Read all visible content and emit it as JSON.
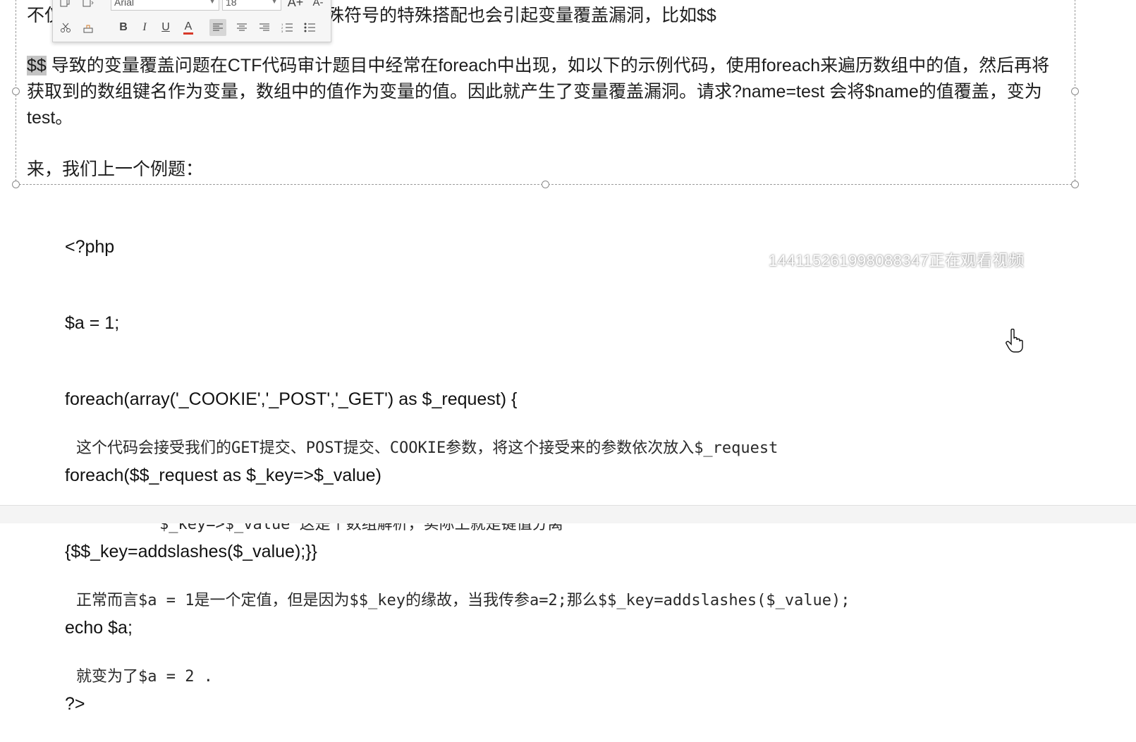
{
  "text_box": {
    "para1": "不仅仅是函数会导致变量覆盖，有些特殊符号的特殊搭配也会引起变量覆盖漏洞，比如$$",
    "para2_selected": "$$",
    "para2_rest": " 导致的变量覆盖问题在CTF代码审计题目中经常在foreach中出现，如以下的示例代码，使用foreach来遍历数组中的值，然后再将获取到的数组键名作为变量，数组中的值作为变量的值。因此就产生了变量覆盖漏洞。请求?name=test 会将$name的值覆盖，变为test。",
    "para3": "来，我们上一个例题："
  },
  "toolbar": {
    "font_name": "Arial",
    "font_size": "18",
    "grow_font": "A+",
    "shrink_font": "A-",
    "bold": "B",
    "italic": "I",
    "underline": "U",
    "font_color": "A"
  },
  "code": {
    "lines": [
      "<?php",
      "$a = 1;",
      "foreach(array('_COOKIE','_POST','_GET') as $_request) {",
      "foreach($$_request as $_key=>$_value)",
      "{$$_key=addslashes($_value);}}",
      "echo $a;",
      "?>"
    ]
  },
  "notes": {
    "line1": "这个代码会接受我们的GET提交、POST提交、COOKIE参数，将这个接受来的参数依次放入$_request",
    "line2": "$_key=>$_value 这是个数组解析，实际上就是键值分离",
    "line3": "正常而言$a = 1是一个定值，但是因为$$_key的缘故，当我传参a=2;那么$$_key=addslashes($_value);",
    "line4": "就变为了$a = 2 ."
  },
  "watermark": "1441152619980883​47正在观看视频",
  "colors": {
    "selection": "#c4c4c4",
    "font_color_bar": "#d83a2a"
  },
  "icons": [
    "copy-icon",
    "paste-icon",
    "cut-icon",
    "format-painter-icon",
    "align-left-icon",
    "align-center-icon",
    "align-right-icon",
    "bullet-list-icon",
    "numbered-list-icon",
    "hand-cursor-icon"
  ]
}
